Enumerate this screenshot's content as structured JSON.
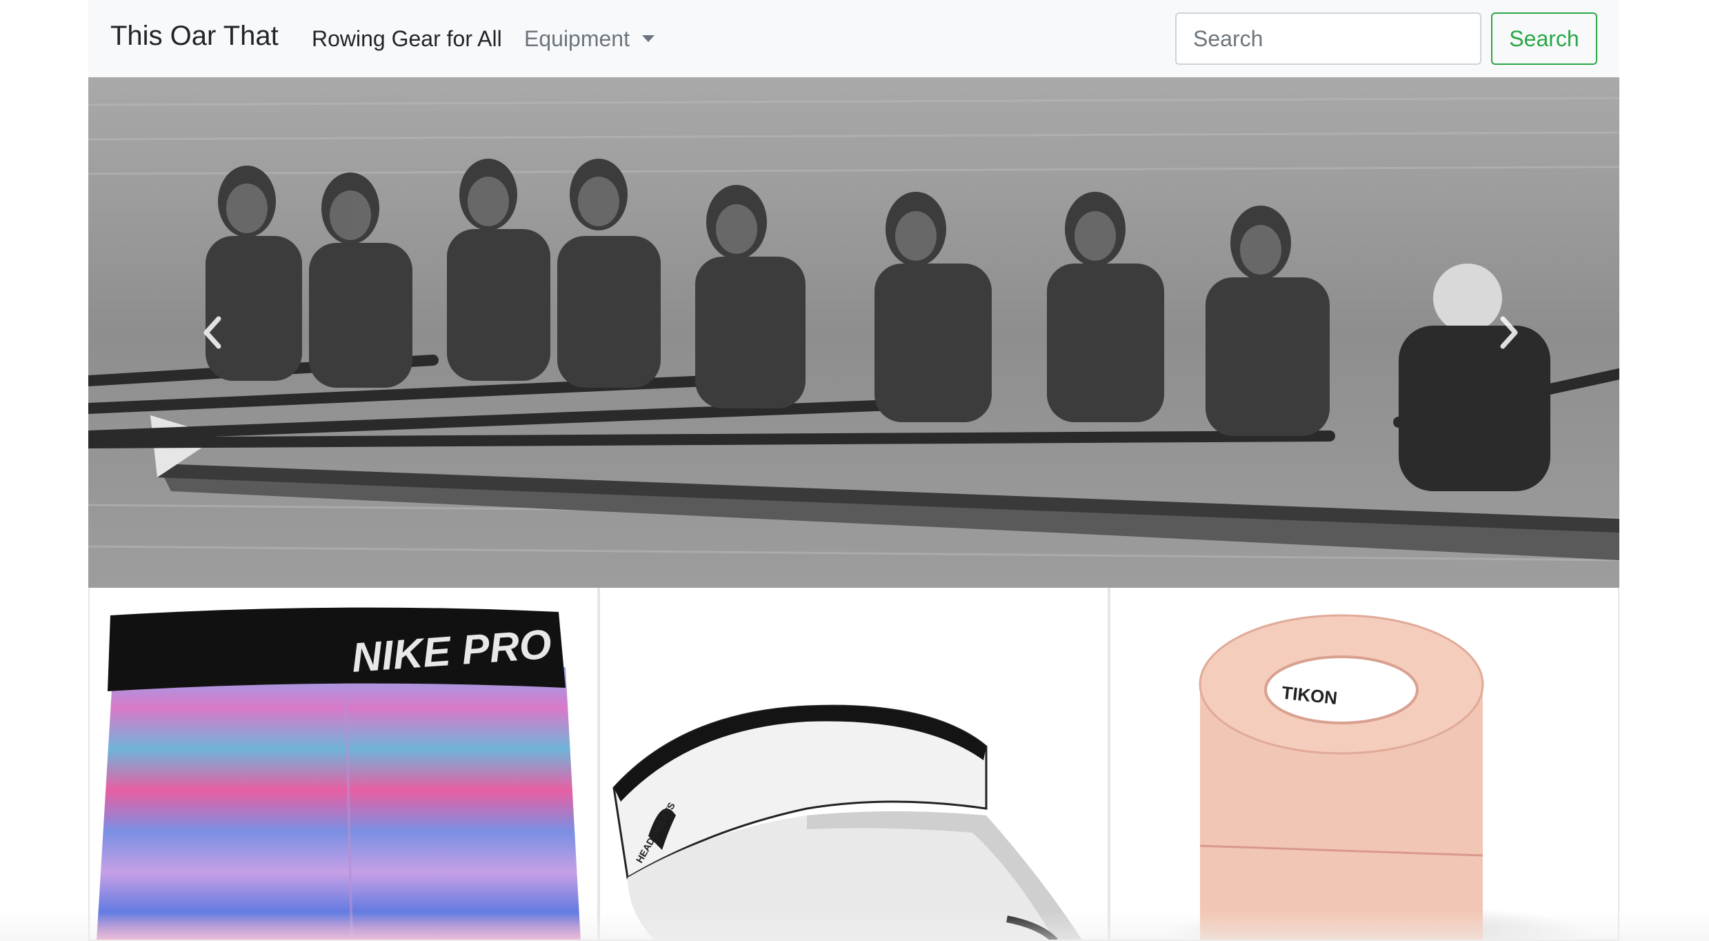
{
  "navbar": {
    "brand": "This Oar That",
    "links": [
      {
        "label": "Rowing Gear for All",
        "active": true
      },
      {
        "label": "Equipment",
        "dropdown": true
      }
    ],
    "search": {
      "placeholder": "Search",
      "value": "",
      "button_label": "Search"
    },
    "accent_color": "#28a745",
    "background": "#f8f9fa"
  },
  "carousel": {
    "slide_description_icon": "rowing-crew-photo",
    "prev_icon": "chevron-left-icon",
    "next_icon": "chevron-right-icon"
  },
  "products": [
    {
      "image_icon": "compression-shorts-photo",
      "brand_text": "NIKE PRO"
    },
    {
      "image_icon": "white-visor-photo",
      "brand_text": "HEADSWEATS"
    },
    {
      "image_icon": "athletic-tape-photo",
      "brand_text": "TIKON"
    }
  ]
}
